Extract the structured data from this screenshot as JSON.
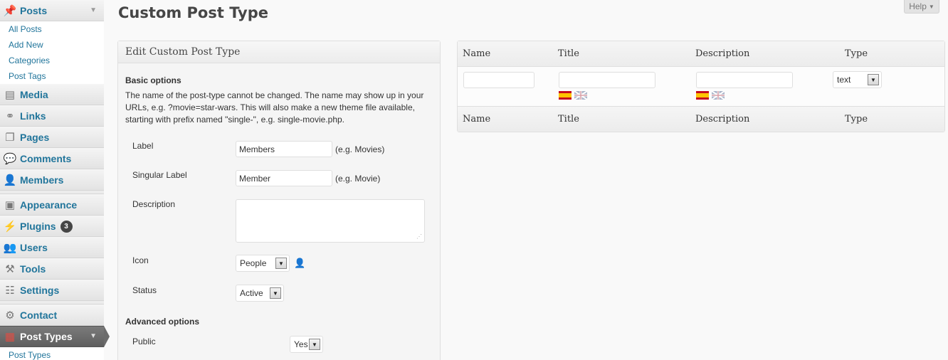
{
  "sidebar": {
    "posts": {
      "label": "Posts",
      "icon": "pushpin-icon"
    },
    "posts_submenu": [
      "All Posts",
      "Add New",
      "Categories",
      "Post Tags"
    ],
    "items": [
      {
        "label": "Media",
        "icon": "media-icon"
      },
      {
        "label": "Links",
        "icon": "link-icon"
      },
      {
        "label": "Pages",
        "icon": "pages-icon"
      },
      {
        "label": "Comments",
        "icon": "comment-icon"
      },
      {
        "label": "Members",
        "icon": "person-icon"
      },
      {
        "label": "Appearance",
        "icon": "appearance-icon"
      },
      {
        "label": "Plugins",
        "icon": "plugin-icon",
        "badge": "3"
      },
      {
        "label": "Users",
        "icon": "users-icon"
      },
      {
        "label": "Tools",
        "icon": "tools-icon"
      },
      {
        "label": "Settings",
        "icon": "settings-icon"
      },
      {
        "label": "Contact",
        "icon": "contact-icon"
      },
      {
        "label": "Post Types",
        "icon": "post-types-icon"
      }
    ],
    "post_types_submenu": [
      "Post Types"
    ]
  },
  "header": {
    "title": "Custom Post Type",
    "help_label": "Help"
  },
  "edit_panel": {
    "heading": "Edit Custom Post Type",
    "basic_options_title": "Basic options",
    "basic_options_help": "The name of the post-type cannot be changed. The name may show up in your URLs, e.g. ?movie=star-wars. This will also make a new theme file available, starting with prefix named \"single-\", e.g. single-movie.php.",
    "fields": {
      "label": {
        "label": "Label",
        "value": "Members",
        "hint": "(e.g. Movies)"
      },
      "singular_label": {
        "label": "Singular Label",
        "value": "Member",
        "hint": "(e.g. Movie)"
      },
      "description": {
        "label": "Description",
        "value": ""
      },
      "icon": {
        "label": "Icon",
        "value": "People"
      },
      "status": {
        "label": "Status",
        "value": "Active"
      }
    },
    "advanced_options_title": "Advanced options",
    "advanced": {
      "public": {
        "label": "Public",
        "value": "Yes"
      }
    }
  },
  "columns_table": {
    "headers": [
      "Name",
      "Title",
      "Description",
      "Type"
    ],
    "new_row": {
      "type_value": "text",
      "languages": [
        "es",
        "en"
      ]
    }
  },
  "colors": {
    "link": "#21759b",
    "current_menu_bg": "#6c6c6c",
    "badge": "#464646"
  }
}
